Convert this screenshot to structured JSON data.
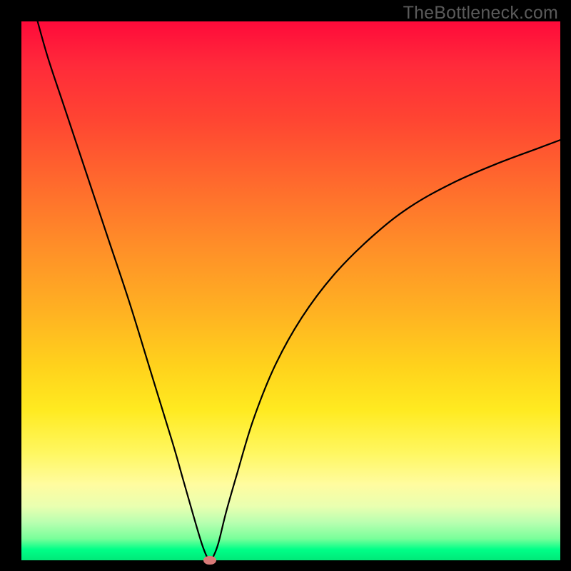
{
  "watermark": "TheBottleneck.com",
  "chart_data": {
    "type": "line",
    "title": "",
    "xlabel": "",
    "ylabel": "",
    "xlim": [
      0,
      100
    ],
    "ylim": [
      0,
      100
    ],
    "series": [
      {
        "name": "bottleneck-curve",
        "x": [
          3,
          5,
          8,
          12,
          16,
          20,
          24,
          28,
          30,
          32,
          33.5,
          34.5,
          35,
          35.5,
          36.5,
          38,
          40,
          43,
          47,
          52,
          58,
          65,
          72,
          80,
          88,
          96,
          100
        ],
        "y": [
          100,
          93,
          84,
          72,
          60,
          48,
          35,
          22,
          15,
          8,
          3,
          0.5,
          0,
          0.5,
          3,
          9,
          16,
          26,
          36,
          45,
          53,
          60,
          65.5,
          70,
          73.5,
          76.5,
          78
        ]
      }
    ],
    "marker": {
      "x": 35,
      "y": 0
    },
    "background_gradient": {
      "top": "#ff0a3a",
      "mid": "#ffd21c",
      "bottom": "#00e878"
    },
    "grid": false,
    "legend": false
  }
}
